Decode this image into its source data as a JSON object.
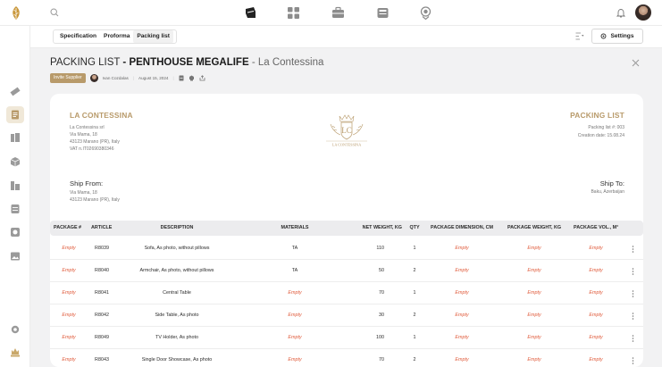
{
  "subbar": {
    "tabs": [
      "Specification",
      "Proforma",
      "Packing list"
    ],
    "settings_label": "Settings"
  },
  "page": {
    "title_prefix": "PACKING LIST",
    "title_dash": "-",
    "project_name": "PENTHOUSE MEGALIFE",
    "title_separator": "-",
    "supplier_name": "La Contessina"
  },
  "meta": {
    "invite_label": "Invite Supplier",
    "user_name": "Ivan Cozdalas",
    "date": "August 15, 2024"
  },
  "document": {
    "company_name": "LA CONTESSINA",
    "company_lines": [
      "La Contessina srl",
      "Via Mama, 18",
      "43123 Marano (PR), Italy",
      "VAT n.IT02690380346"
    ],
    "crest_text": "LA CONTESSINA",
    "doc_title": "PACKING LIST",
    "doc_number": "Packing list #: 003",
    "creation_date": "Creation date: 15.08.24",
    "ship_from_label": "Ship From:",
    "ship_from_lines": [
      "Via Mama, 18",
      "43123 Marano (PR), Italy"
    ],
    "ship_to_label": "Ship To:",
    "ship_to_line": "Baku, Azerbaijan"
  },
  "table": {
    "headers": [
      "PACKAGE #",
      "ARTICLE",
      "DESCRIPTION",
      "MATERIALS",
      "NET WEIGHT, KG",
      "QTY",
      "PACKAGE DIMENSION, CM",
      "PACKAGE WEIGHT, KG",
      "PACKAGE VOL., M³"
    ],
    "rows": [
      {
        "package": "Empty",
        "article": "R8039",
        "description": "Sofa, As photo, without pillows",
        "materials": "TA",
        "net_weight": "110",
        "qty": "1",
        "dimension": "Empty",
        "weight": "Empty",
        "volume": "Empty"
      },
      {
        "package": "Empty",
        "article": "R8040",
        "description": "Armchair, As photo, without pillows",
        "materials": "TA",
        "net_weight": "50",
        "qty": "2",
        "dimension": "Empty",
        "weight": "Empty",
        "volume": "Empty"
      },
      {
        "package": "Empty",
        "article": "R8041",
        "description": "Central Table",
        "materials": "Empty",
        "net_weight": "70",
        "qty": "1",
        "dimension": "Empty",
        "weight": "Empty",
        "volume": "Empty"
      },
      {
        "package": "Empty",
        "article": "R8042",
        "description": "Side Table, As photo",
        "materials": "Empty",
        "net_weight": "30",
        "qty": "2",
        "dimension": "Empty",
        "weight": "Empty",
        "volume": "Empty"
      },
      {
        "package": "Empty",
        "article": "R8049",
        "description": "TV Holder, As photo",
        "materials": "Empty",
        "net_weight": "100",
        "qty": "1",
        "dimension": "Empty",
        "weight": "Empty",
        "volume": "Empty"
      },
      {
        "package": "Empty",
        "article": "R8043",
        "description": "Single Door Showcase, As photo",
        "materials": "Empty",
        "net_weight": "70",
        "qty": "2",
        "dimension": "Empty",
        "weight": "Empty",
        "volume": "Empty"
      }
    ]
  },
  "icons": {
    "logo": "leaf-logo-icon",
    "search": "search-icon",
    "nav": [
      "furniture-icon",
      "grid-icon",
      "briefcase-icon",
      "inbox-icon",
      "location-icon"
    ],
    "bell": "bell-icon",
    "filter": "filter-icon",
    "gear": "gear-icon",
    "close": "close-icon",
    "sidebar": [
      "ruler-icon",
      "document-icon",
      "books-icon",
      "box-icon",
      "catalog-icon",
      "archive-icon",
      "layers-icon",
      "image-icon",
      "settings-icon",
      "brand-icon"
    ]
  },
  "colors": {
    "accent": "#b89a6a",
    "empty_text": "#e05c3c",
    "background": "#f2f2f3",
    "active_tab_bg": "#f1f1f1"
  }
}
